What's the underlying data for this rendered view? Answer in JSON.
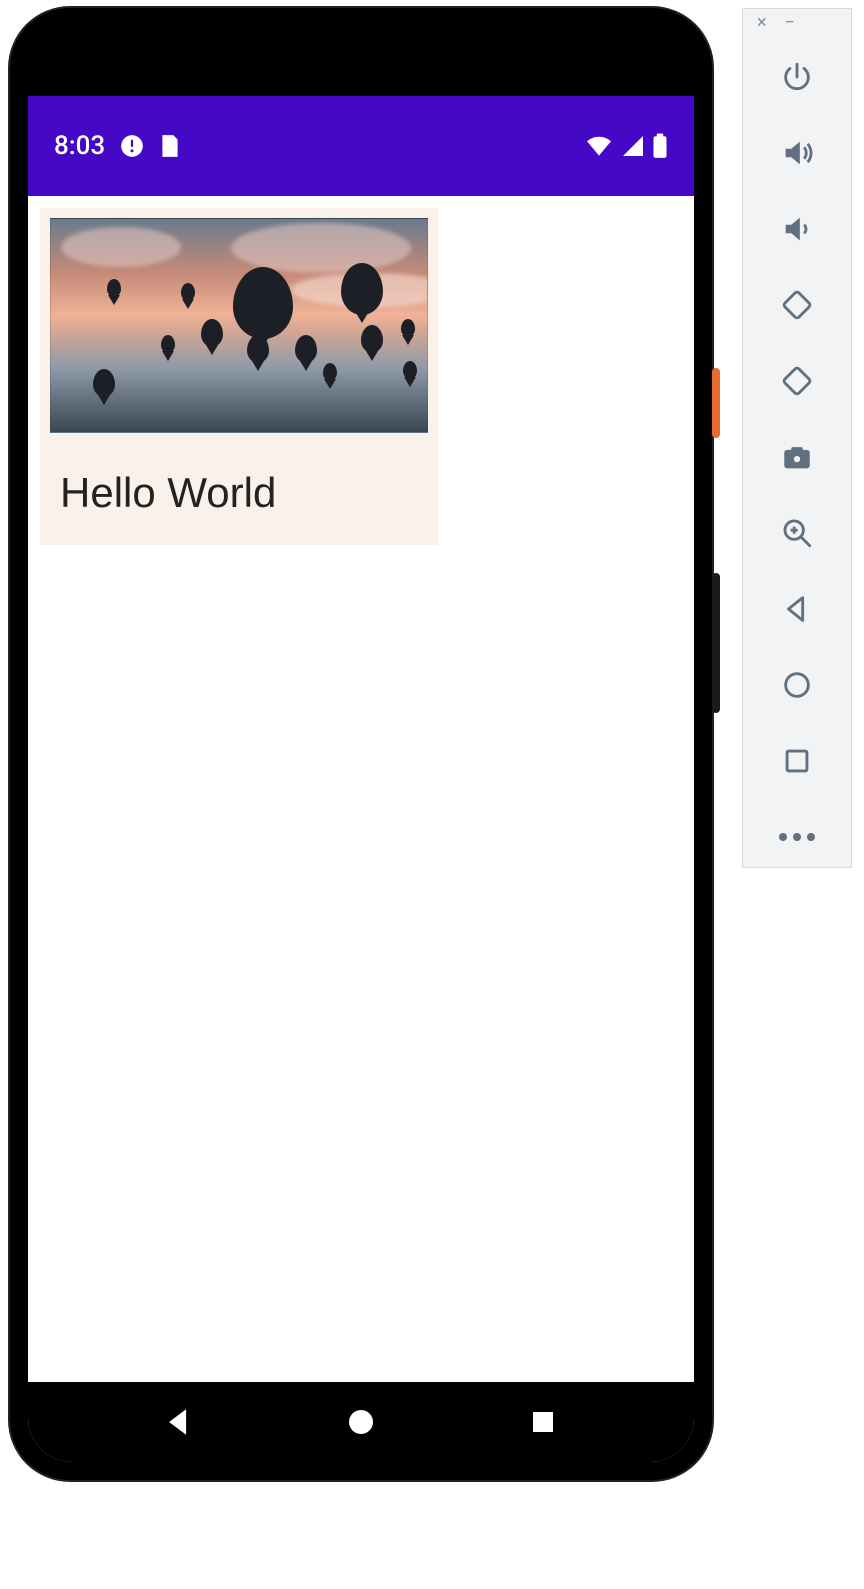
{
  "statusbar": {
    "time": "8:03",
    "icons_left": [
      "clock-alert-icon",
      "sim-icon"
    ],
    "icons_right": [
      "wifi-icon",
      "signal-icon",
      "battery-icon"
    ]
  },
  "app": {
    "card": {
      "title": "Hello World",
      "image_alt": "hot air balloons at sunset"
    }
  },
  "navbar": {
    "buttons": [
      "back",
      "home",
      "recent"
    ]
  },
  "emulator_sidebar": {
    "window_controls": [
      "close",
      "minimize"
    ],
    "buttons": [
      "power",
      "volume-up",
      "volume-down",
      "rotate-left",
      "rotate-right",
      "screenshot",
      "zoom",
      "back",
      "home",
      "overview",
      "more"
    ]
  }
}
